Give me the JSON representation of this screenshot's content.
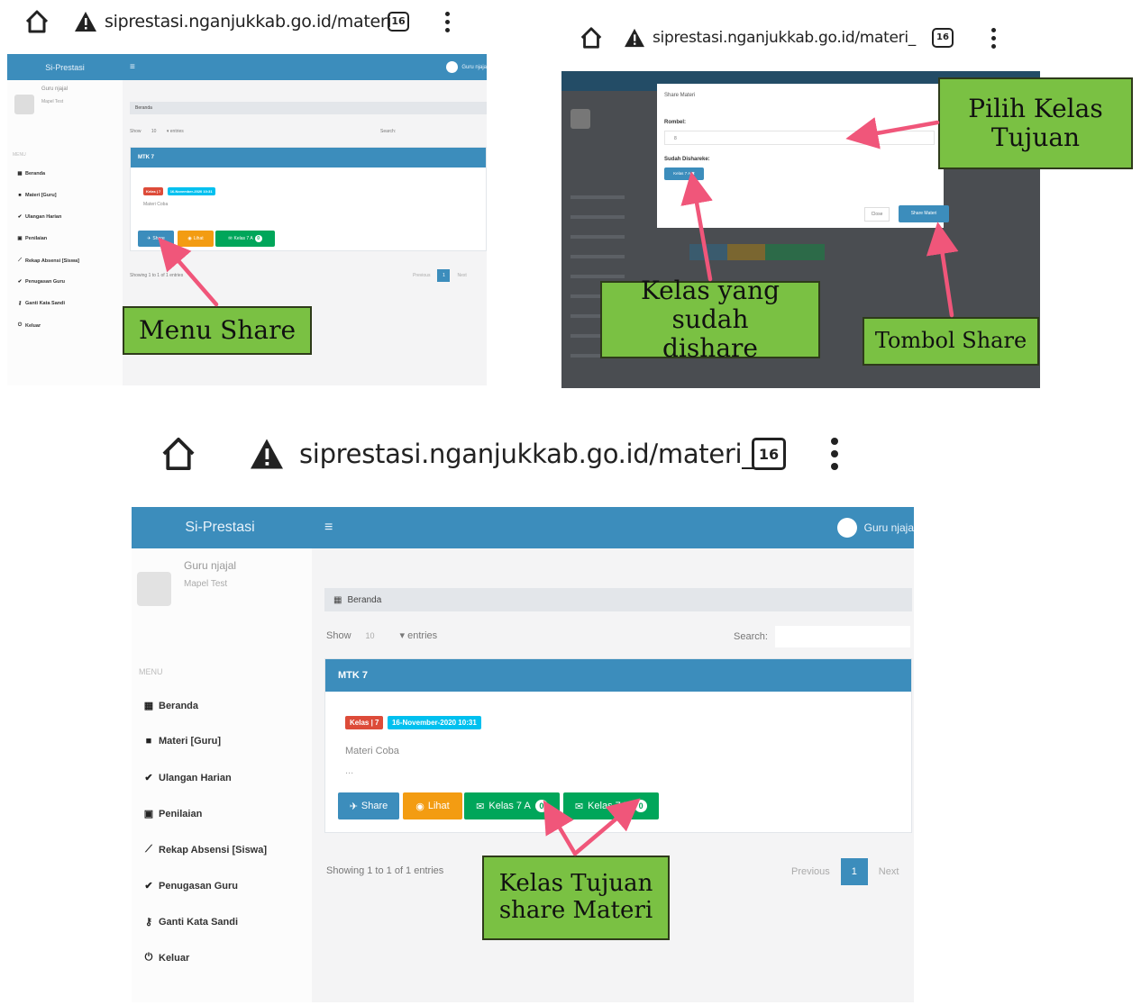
{
  "browser": {
    "url": "siprestasi.nganjukkab.go.id/materi_",
    "tab_count": "16",
    "home_icon": "home-icon",
    "warning_icon": "warning-icon",
    "menu_icon": "more-vert-icon"
  },
  "app": {
    "brand": "Si-Prestasi",
    "hamburger": "≡",
    "user_name": "Guru njajal",
    "user_name_short": "Guru njaja",
    "user_subtitle": "Mapel Test",
    "menu_header": "MENU",
    "menu": [
      {
        "label": "Beranda",
        "icon": "dashboard-icon"
      },
      {
        "label": "Materi [Guru]",
        "icon": "folder-icon"
      },
      {
        "label": "Ulangan Harian",
        "icon": "check-icon"
      },
      {
        "label": "Penilaian",
        "icon": "grade-icon"
      },
      {
        "label": "Rekap Absensi [Siswa]",
        "icon": "chart-icon"
      },
      {
        "label": "Penugasan Guru",
        "icon": "check-icon"
      },
      {
        "label": "Ganti Kata Sandi",
        "icon": "key-icon"
      },
      {
        "label": "Keluar",
        "icon": "power-icon"
      }
    ],
    "breadcrumb": "Beranda",
    "show_label": "Show",
    "entries_value": "10",
    "entries_label": "entries",
    "search_label": "Search:",
    "card_title": "MTK 7",
    "badge_class": "Kelas | 7",
    "badge_date": "16-November-2020 10:31",
    "materi_title": "Materi Coba",
    "ellipsis": "...",
    "btn_share": "Share",
    "btn_lihat": "Lihat",
    "btn_kelas_a": "Kelas 7 A",
    "btn_kelas_b": "Kelas 7 B",
    "btn_count": "0",
    "showing": "Showing 1 to 1 of 1 entries",
    "previous": "Previous",
    "page": "1",
    "next": "Next"
  },
  "modal": {
    "title": "Share Materi",
    "rombel_label": "Rombel:",
    "rombel_value": "8",
    "shared_label": "Sudah Dishareke:",
    "shared_tag": "Kelas 7 A ✖",
    "close": "Close",
    "submit": "Share Materi"
  },
  "callouts": {
    "menu_share": "Menu Share",
    "pilih_kelas": "Pilih Kelas Tujuan",
    "kelas_sudah": "Kelas yang sudah dishare",
    "tombol_share": "Tombol Share",
    "kelas_tujuan": "Kelas Tujuan share Materi"
  },
  "colors": {
    "primary": "#3c8dbc",
    "danger": "#dd4b39",
    "warning": "#f39c12",
    "success": "#00a65a",
    "callout": "#7ac143",
    "arrow": "#f0567a"
  }
}
